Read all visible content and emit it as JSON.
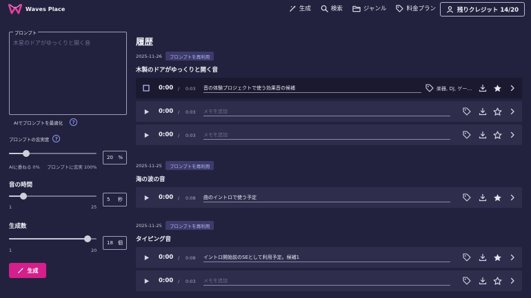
{
  "header": {
    "logo_text": "Waves Place",
    "nav": [
      "生成",
      "検索",
      "ジャンル",
      "料金プラン"
    ],
    "credit_label": "残りクレジット 14/20"
  },
  "left": {
    "prompt_legend": "プロンプト",
    "prompt_placeholder": "木星のドアがゆっくりと開く音",
    "optimize_label": "AIでプロンプトを最適化",
    "fidelity_label": "プロンプトの忠実度",
    "fidelity_value": "20",
    "fidelity_unit": "%",
    "fidelity_level": 0.2,
    "fidelity_min_label": "AIに委ねる 0%",
    "fidelity_max_label": "プロンプトに忠実 100%",
    "duration_label": "音の時間",
    "duration_value": "5",
    "duration_unit": "秒",
    "duration_level": 5,
    "duration_min": "1",
    "duration_max": "25",
    "count_label": "生成数",
    "count_value": "18",
    "count_unit": "個",
    "count_level": 18,
    "count_min": "1",
    "count_max": "20",
    "generate_label": "生成"
  },
  "history": {
    "title": "履歴",
    "reuse_label": "プロンプトを再利用",
    "memo_placeholder": "メモを追加",
    "groups": [
      {
        "date": "2025-11-26",
        "title": "木製のドアがゆっくりと開く音",
        "rows": [
          {
            "time": "0:00",
            "duration": "0:03",
            "memo": "音の体験プロジェクトで使う効果音の候補",
            "tags": "楽器, DJ, ゲー…",
            "starred": true,
            "selected": true
          },
          {
            "time": "0:00",
            "duration": "0:03",
            "memo": "",
            "tags": "",
            "starred": false,
            "selected": false
          },
          {
            "time": "0:00",
            "duration": "0:03",
            "memo": "",
            "tags": "",
            "starred": false,
            "selected": false
          }
        ]
      },
      {
        "date": "2025-11-25",
        "title": "海の波の音",
        "rows": [
          {
            "time": "0:00",
            "duration": "0:08",
            "memo": "曲のイントロで使う予定",
            "tags": "",
            "starred": true,
            "selected": false
          }
        ]
      },
      {
        "date": "2025-11-25",
        "title": "タイピング音",
        "rows": [
          {
            "time": "0:00",
            "duration": "0:08",
            "memo": "イントロ開始前のSEとして利用予定。候補1",
            "tags": "",
            "starred": true,
            "selected": false
          },
          {
            "time": "0:00",
            "duration": "0:03",
            "memo": "",
            "tags": "",
            "starred": false,
            "selected": false
          }
        ]
      }
    ]
  },
  "colors": {
    "background": "#23223e",
    "row": "#2e2d4c",
    "row_selected": "#1a1930",
    "accent": "#d51f8a",
    "reuse_badge": "#3c3b6b",
    "help": "#8f96ee"
  }
}
